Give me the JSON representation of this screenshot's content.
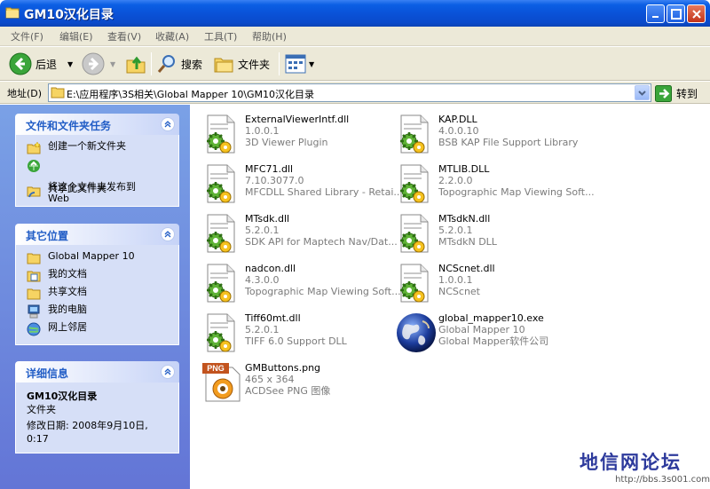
{
  "window": {
    "title": "GM10汉化目录"
  },
  "menu": [
    "文件(F)",
    "编辑(E)",
    "查看(V)",
    "收藏(A)",
    "工具(T)",
    "帮助(H)"
  ],
  "toolbar": {
    "back": "后退",
    "search": "搜索",
    "folders": "文件夹"
  },
  "address": {
    "label": "地址(D)",
    "path": "E:\\应用程序\\3S相关\\Global Mapper 10\\GM10汉化目录",
    "go": "转到"
  },
  "tasks_panel": {
    "title": "文件和文件夹任务",
    "items": [
      {
        "label": "创建一个新文件夹",
        "icon": "new-folder-icon"
      },
      {
        "label": "将这个文件夹发布到\nWeb",
        "icon": "publish-web-icon"
      },
      {
        "label": "共享此文件夹",
        "icon": "share-folder-icon"
      }
    ]
  },
  "places_panel": {
    "title": "其它位置",
    "items": [
      {
        "label": "Global Mapper 10",
        "icon": "folder-icon"
      },
      {
        "label": "我的文档",
        "icon": "my-documents-icon"
      },
      {
        "label": "共享文档",
        "icon": "shared-documents-icon"
      },
      {
        "label": "我的电脑",
        "icon": "my-computer-icon"
      },
      {
        "label": "网上邻居",
        "icon": "network-icon"
      }
    ]
  },
  "details_panel": {
    "title": "详细信息",
    "name": "GM10汉化目录",
    "type": "文件夹",
    "modified": "修改日期: 2008年9月10日,\n0:17"
  },
  "files": [
    {
      "name": "ExternalViewerIntf.dll",
      "line2": "1.0.0.1",
      "line3": "3D Viewer Plugin",
      "icon": "dll-icon"
    },
    {
      "name": "KAP.DLL",
      "line2": "4.0.0.10",
      "line3": "BSB KAP File Support Library",
      "icon": "dll-icon"
    },
    {
      "name": "MFC71.dll",
      "line2": "7.10.3077.0",
      "line3": "MFCDLL Shared Library - Retai...",
      "icon": "dll-icon"
    },
    {
      "name": "MTLIB.DLL",
      "line2": "2.2.0.0",
      "line3": "Topographic Map Viewing Soft...",
      "icon": "dll-icon"
    },
    {
      "name": "MTsdk.dll",
      "line2": "5.2.0.1",
      "line3": "SDK API for Maptech Nav/Dat...",
      "icon": "dll-icon"
    },
    {
      "name": "MTsdkN.dll",
      "line2": "5.2.0.1",
      "line3": "MTsdkN DLL",
      "icon": "dll-icon"
    },
    {
      "name": "nadcon.dll",
      "line2": "4.3.0.0",
      "line3": "Topographic Map Viewing Soft...",
      "icon": "dll-icon"
    },
    {
      "name": "NCScnet.dll",
      "line2": "1.0.0.1",
      "line3": "NCScnet",
      "icon": "dll-icon"
    },
    {
      "name": "Tiff60mt.dll",
      "line2": "5.2.0.1",
      "line3": "TIFF 6.0 Support DLL",
      "icon": "dll-icon"
    },
    {
      "name": "global_mapper10.exe",
      "line2": "Global Mapper 10",
      "line3": "Global Mapper软件公司",
      "icon": "globe-exe-icon"
    },
    {
      "name": "GMButtons.png",
      "line2": "465 x 364",
      "line3": "ACDSee PNG 图像",
      "icon": "png-file-icon",
      "badge": "PNG"
    }
  ],
  "watermark": {
    "title": "地信网论坛",
    "url": "http://bbs.3s001.com"
  }
}
